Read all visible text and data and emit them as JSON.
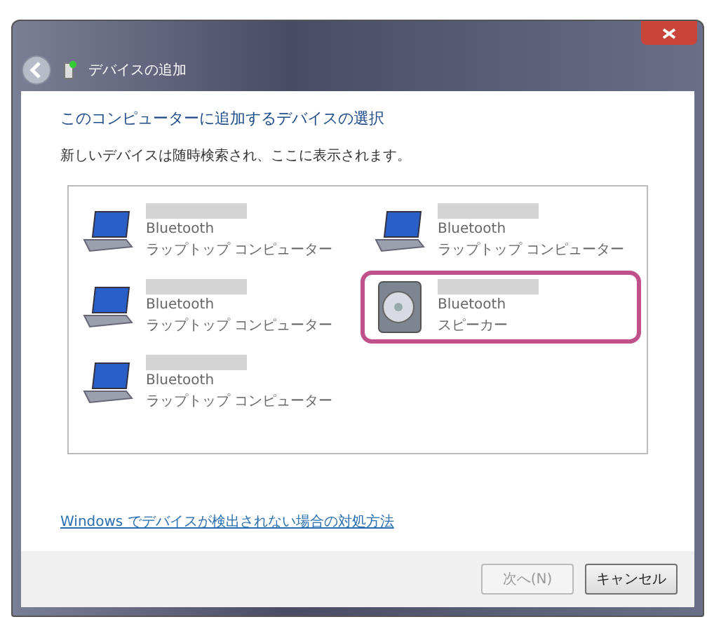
{
  "window": {
    "title": "デバイスの追加"
  },
  "heading": "このコンピューターに追加するデバイスの選択",
  "subheading": "新しいデバイスは随時検索され、ここに表示されます。",
  "devices": [
    {
      "kind": "laptop",
      "type": "Bluetooth",
      "category": "ラップトップ コンピューター",
      "selected": false
    },
    {
      "kind": "laptop",
      "type": "Bluetooth",
      "category": "ラップトップ コンピューター",
      "selected": false
    },
    {
      "kind": "laptop",
      "type": "Bluetooth",
      "category": "ラップトップ コンピューター",
      "selected": false
    },
    {
      "kind": "laptop",
      "type": "Bluetooth",
      "category": "ラップトップ コンピューター",
      "selected": false
    },
    {
      "kind": "speaker",
      "type": "Bluetooth",
      "category": "スピーカー",
      "selected": true
    }
  ],
  "help_link": "Windows でデバイスが検出されない場合の対処方法",
  "buttons": [
    {
      "label": "次へ(N)",
      "disabled": true
    },
    {
      "label": "キャンセル",
      "disabled": false
    }
  ]
}
